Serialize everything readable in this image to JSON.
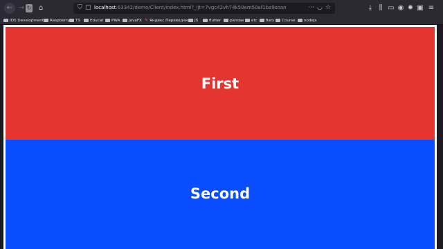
{
  "browser": {
    "url_host": "localhost",
    "url_rest": ":63342/demo/Client/index.html?_ijt=7vgc42vh74k50em50af1ba9soan"
  },
  "bookmarks": [
    {
      "label": "IOS Development",
      "icon": "folder-icon"
    },
    {
      "label": "Raspberry",
      "icon": "folder-icon"
    },
    {
      "label": "TS",
      "icon": "folder-icon"
    },
    {
      "label": "Educat",
      "icon": "folder-icon"
    },
    {
      "label": "PWA",
      "icon": "folder-icon"
    },
    {
      "label": "JavaFX",
      "icon": "folder-icon"
    },
    {
      "label": "Яндекс.Переводчи...",
      "icon": "translate-icon"
    },
    {
      "label": "JS",
      "icon": "folder-icon"
    },
    {
      "label": "flutter",
      "icon": "folder-icon"
    },
    {
      "label": "pandas",
      "icon": "folder-icon"
    },
    {
      "label": "etc",
      "icon": "folder-icon"
    },
    {
      "label": "flats",
      "icon": "folder-icon"
    },
    {
      "label": "Course",
      "icon": "folder-icon"
    },
    {
      "label": "nodejs",
      "icon": "folder-icon"
    }
  ],
  "panels": [
    {
      "title": "First",
      "color": "#e3342f"
    },
    {
      "title": "Second",
      "color": "#0a4dff"
    }
  ]
}
